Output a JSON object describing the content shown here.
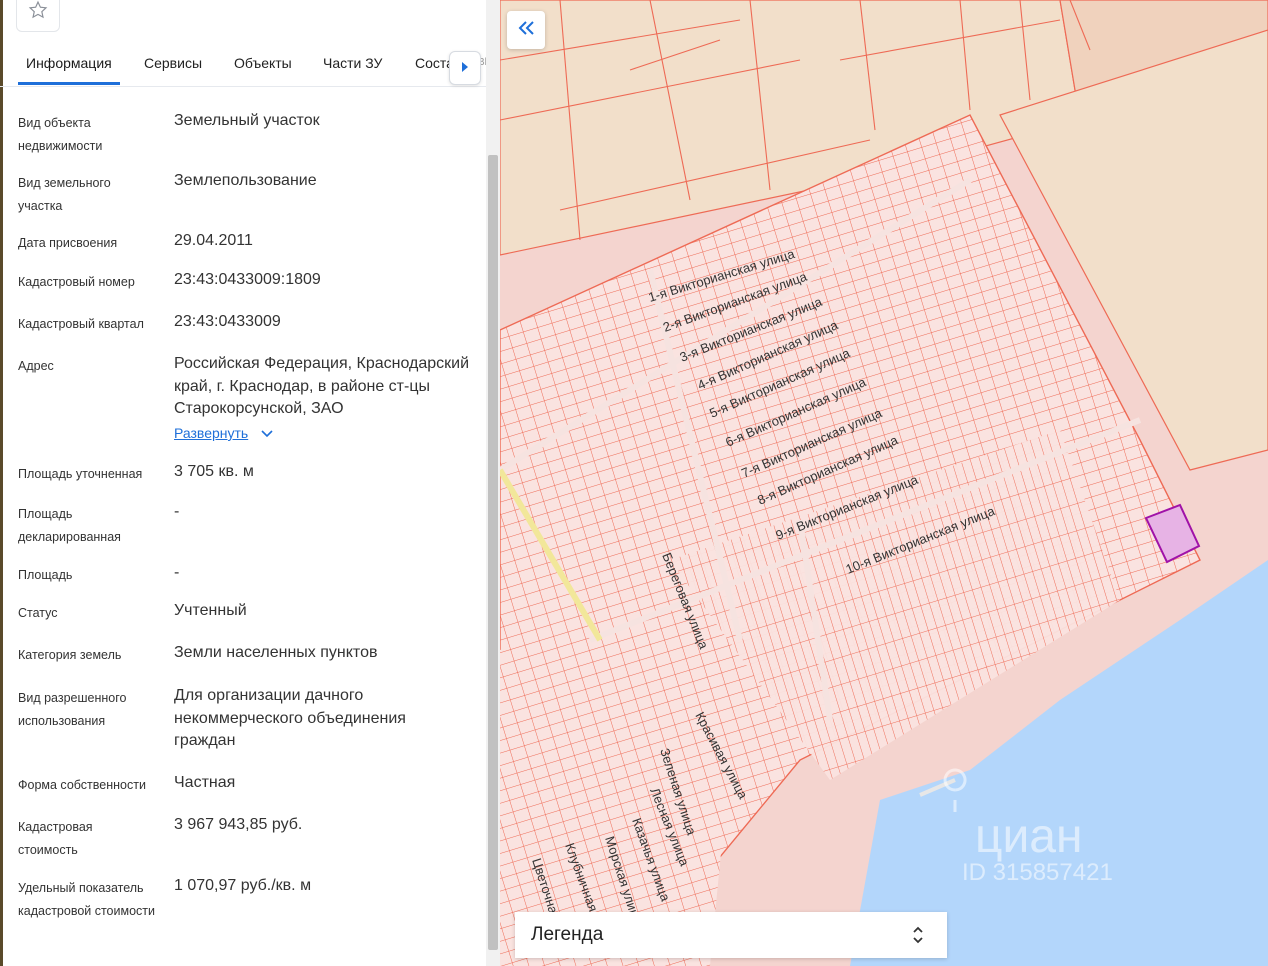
{
  "tabs": [
    {
      "label": "Информация",
      "active": true
    },
    {
      "label": "Сервисы",
      "active": false
    },
    {
      "label": "Объекты",
      "active": false
    },
    {
      "label": "Части ЗУ",
      "active": false
    },
    {
      "label": "Соста",
      "active": false
    }
  ],
  "tabs_overflow_text": "Bl",
  "info": {
    "object_type": {
      "label": "Вид объекта недвижимости",
      "value": "Земельный участок"
    },
    "land_type": {
      "label": "Вид земельного участка",
      "value": "Землепользование"
    },
    "assigned_date": {
      "label": "Дата присвоения",
      "value": "29.04.2011"
    },
    "cadastral_number": {
      "label": "Кадастровый номер",
      "value": "23:43:0433009:1809"
    },
    "cadastral_block": {
      "label": "Кадастровый квартал",
      "value": "23:43:0433009"
    },
    "address": {
      "label": "Адрес",
      "value": "Российская Федерация, Краснодарский край, г. Краснодар, в районе ст-цы Старокорсунской, ЗАО",
      "expand_label": "Развернуть"
    },
    "area_refined": {
      "label": "Площадь уточненная",
      "value": "3 705 кв. м"
    },
    "area_declared": {
      "label": "Площадь декларированная",
      "value": "-"
    },
    "area": {
      "label": "Площадь",
      "value": "-"
    },
    "status": {
      "label": "Статус",
      "value": "Учтенный"
    },
    "land_category": {
      "label": "Категория земель",
      "value": "Земли населенных пунктов"
    },
    "permitted_use": {
      "label": "Вид разрешенного использования",
      "value": "Для организации дачного некоммерческого объединения граждан"
    },
    "ownership": {
      "label": "Форма собственности",
      "value": "Частная"
    },
    "cadastral_value": {
      "label": "Кадастровая стоимость",
      "value": "3 967 943,85 руб."
    },
    "specific_value": {
      "label": "Удельный показатель кадастровой стоимости",
      "value": "1 070,97 руб./кв. м"
    }
  },
  "map": {
    "legend_label": "Легенда",
    "watermark_brand": "циан",
    "watermark_id": "ID 315857421",
    "streets": [
      "1-я Викторианская улица",
      "2-я Викторианская улица",
      "3-я Викторианская улица",
      "4-я Викторианская улица",
      "5-я Викторианская улица",
      "6-я Викторианская улица",
      "7-я Викторианская улица",
      "8-я Викторианская улица",
      "9-я Викторианская улица",
      "10-я Викторианская улица",
      "Береговая улица",
      "Красивая улица",
      "Зеленая улица",
      "Лесная улица",
      "Казачья улица",
      "Морская улица",
      "Клубничная",
      "Цветочная"
    ],
    "colors": {
      "parcel_line": "#ee6a55",
      "parcel_fill": "#f8dcd8",
      "water": "#b3d6fb",
      "sand": "#f2dfca",
      "selected": "#a012a8"
    }
  },
  "icons": {
    "favorite": "star-icon",
    "tab_next": "caret-right-icon",
    "collapse": "double-chevron-left-icon",
    "legend_toggle": "chevron-up-down-icon",
    "expand": "chevron-down-icon"
  }
}
